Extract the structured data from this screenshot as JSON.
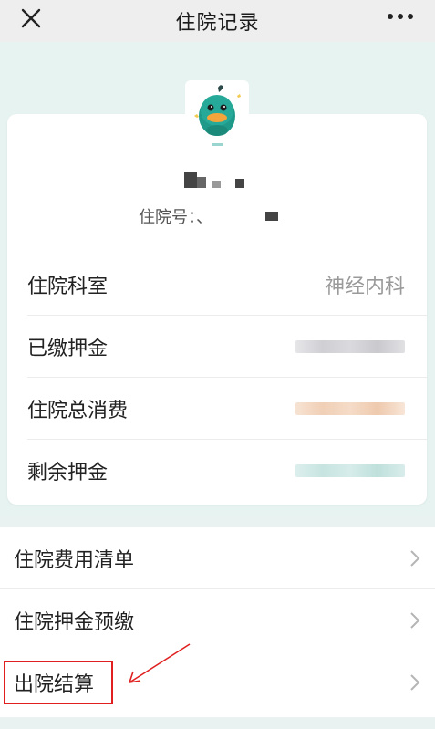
{
  "header": {
    "title": "住院记录"
  },
  "patient": {
    "inpatient_number_label": "住院号：、"
  },
  "info_rows": [
    {
      "label": "住院科室",
      "value": "神经内科"
    },
    {
      "label": "已缴押金",
      "value": ""
    },
    {
      "label": "住院总消费",
      "value": ""
    },
    {
      "label": "剩余押金",
      "value": ""
    }
  ],
  "menu": [
    {
      "label": "住院费用清单"
    },
    {
      "label": "住院押金预缴"
    },
    {
      "label": "出院结算"
    }
  ],
  "colors": {
    "deposit_paid_blur": "#d7d7db",
    "total_cost_blur": "#f4d9c4",
    "remaining_blur": "#cfe7e5",
    "highlight": "#e02020"
  },
  "icons": {
    "close": "close-icon",
    "more": "more-dots-icon",
    "chevron": "chevron-right-icon",
    "avatar": "duck-avatar-icon"
  }
}
